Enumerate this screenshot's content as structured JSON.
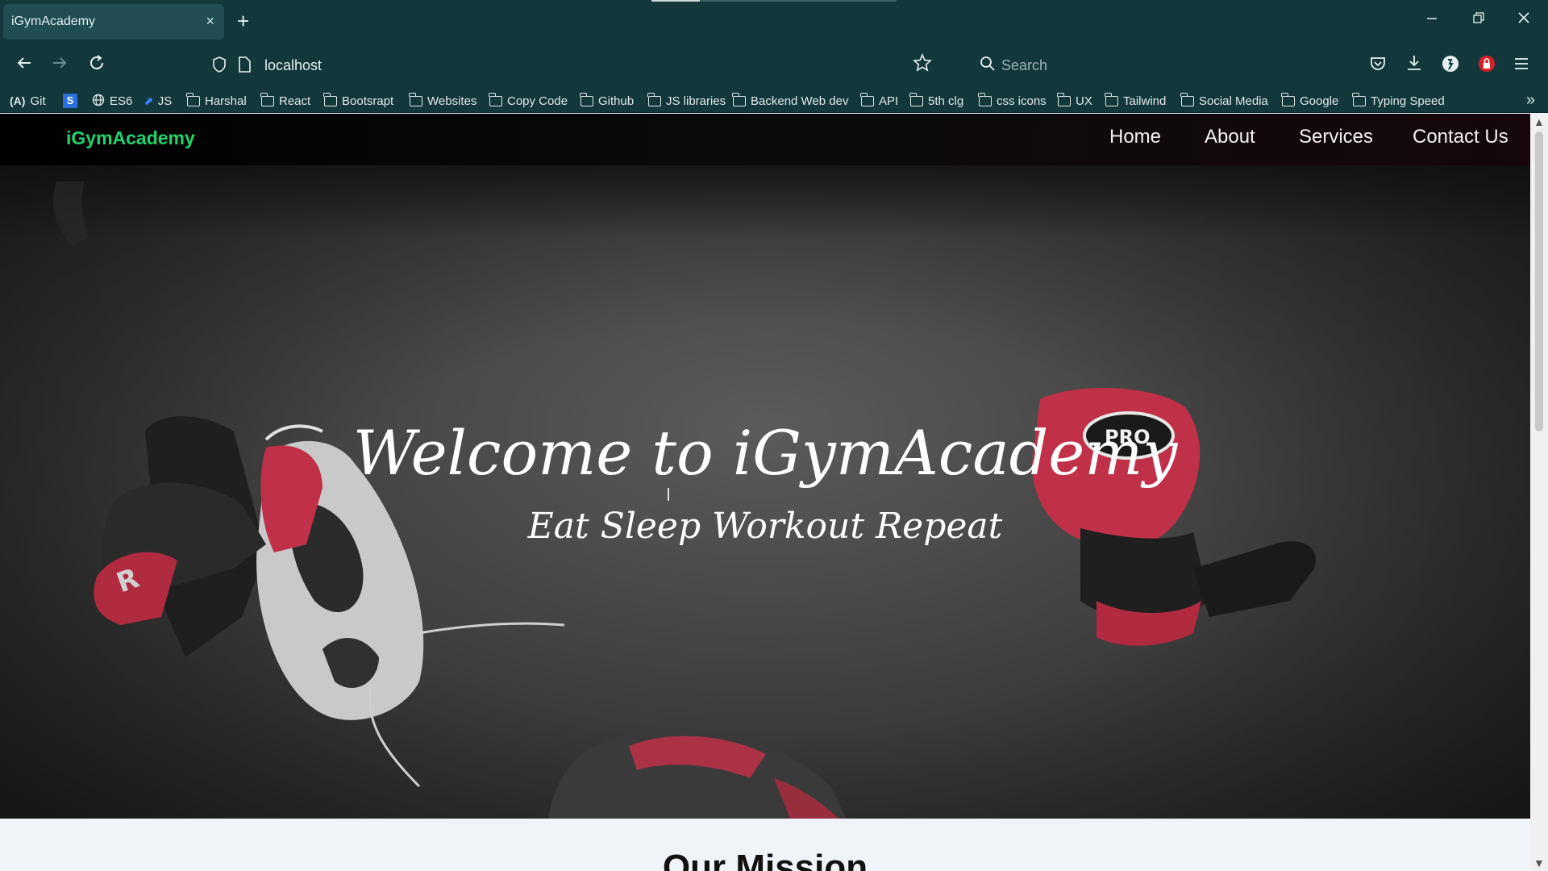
{
  "browser": {
    "tab_title": "iGymAcademy",
    "tab_close": "×",
    "new_tab": "+",
    "url": "localhost",
    "search_placeholder": "Search",
    "bookmarks_overflow": "»",
    "bookmarks": [
      {
        "label": "Git",
        "icon": "git-icon"
      },
      {
        "label": "",
        "icon": "s-square-icon"
      },
      {
        "label": "ES6",
        "icon": "globe-icon"
      },
      {
        "label": "JS",
        "icon": "js-icon"
      },
      {
        "label": "Harshal",
        "icon": "folder-icon"
      },
      {
        "label": "React",
        "icon": "folder-icon"
      },
      {
        "label": "Bootsrapt",
        "icon": "folder-icon"
      },
      {
        "label": "Websites",
        "icon": "folder-icon"
      },
      {
        "label": "Copy Code",
        "icon": "folder-icon"
      },
      {
        "label": "Github",
        "icon": "folder-icon"
      },
      {
        "label": "JS libraries",
        "icon": "folder-icon"
      },
      {
        "label": "Backend Web dev",
        "icon": "folder-icon"
      },
      {
        "label": "API",
        "icon": "folder-icon"
      },
      {
        "label": "5th clg",
        "icon": "folder-icon"
      },
      {
        "label": "css icons",
        "icon": "folder-icon"
      },
      {
        "label": "UX",
        "icon": "folder-icon"
      },
      {
        "label": "Tailwind",
        "icon": "folder-icon"
      },
      {
        "label": "Social Media",
        "icon": "folder-icon"
      },
      {
        "label": "Google",
        "icon": "folder-icon"
      },
      {
        "label": "Typing Speed",
        "icon": "folder-icon"
      }
    ]
  },
  "site": {
    "brand": "iGymAcademy",
    "brand_color": "#21d46a",
    "menu": [
      "Home",
      "About",
      "Services",
      "Contact Us"
    ],
    "hero_title": "Welcome to iGymAcademy",
    "hero_subtitle": "Eat Sleep Workout Repeat",
    "mission_title": "Our Mission"
  },
  "colors": {
    "chrome": "#12383c",
    "tab_active": "#1f4d52",
    "glove_red": "#c03048"
  }
}
